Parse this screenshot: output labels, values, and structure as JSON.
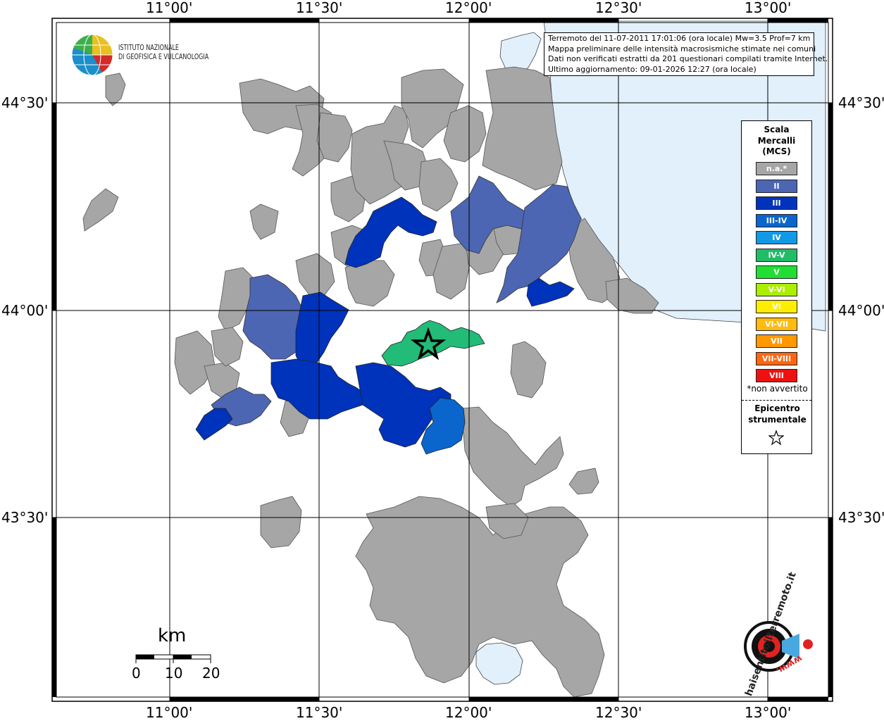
{
  "map": {
    "lon_labels": [
      "11°00'",
      "11°30'",
      "12°00'",
      "12°30'",
      "13°00'"
    ],
    "lat_labels": [
      "44°30'",
      "44°00'",
      "43°30'"
    ]
  },
  "institute": {
    "line1": "ISTITUTO NAZIONALE",
    "line2": "DI GEOFISICA E VULCANOLOGIA"
  },
  "info": {
    "line1": "Terremoto del 11-07-2011 17:01:06 (ora locale) Mw=3.5 Prof=7 km",
    "line2": "Mappa preliminare delle intensità macrosismiche stimate nei comuni",
    "line3": "Dati non verificati estratti da 201 questionari compilati tramite Internet.",
    "line4": "Ultimo aggiornamento: 09-01-2026 12:27 (ora locale)"
  },
  "legend": {
    "title_line1": "Scala",
    "title_line2": "Mercalli",
    "title_line3": "(MCS)",
    "items": [
      {
        "label": "n.a.*",
        "color": "#a6a6a6"
      },
      {
        "label": "II",
        "color": "#4d66b3"
      },
      {
        "label": "III",
        "color": "#0033bb"
      },
      {
        "label": "III-IV",
        "color": "#0a66cc"
      },
      {
        "label": "IV",
        "color": "#1199e6"
      },
      {
        "label": "IV-V",
        "color": "#22bb66"
      },
      {
        "label": "V",
        "color": "#22dd33"
      },
      {
        "label": "V-VI",
        "color": "#aaee00"
      },
      {
        "label": "VI",
        "color": "#ffee00"
      },
      {
        "label": "VI-VII",
        "color": "#ffbb11"
      },
      {
        "label": "VII",
        "color": "#ff9900"
      },
      {
        "label": "VII-VIII",
        "color": "#ff6611"
      },
      {
        "label": "VIII",
        "color": "#ee1111"
      }
    ],
    "note": "*non avvertito",
    "epicenter_line1": "Epicentro",
    "epicenter_line2": "strumentale"
  },
  "scalebar": {
    "unit": "km",
    "labels": [
      "0",
      "10",
      "20"
    ]
  },
  "haisentito": {
    "text": "haisentitoilterremoto.it",
    "www": "www."
  },
  "colors": {
    "sea": "#e1f0fb",
    "land_border": "#555555",
    "grid": "#000000"
  }
}
